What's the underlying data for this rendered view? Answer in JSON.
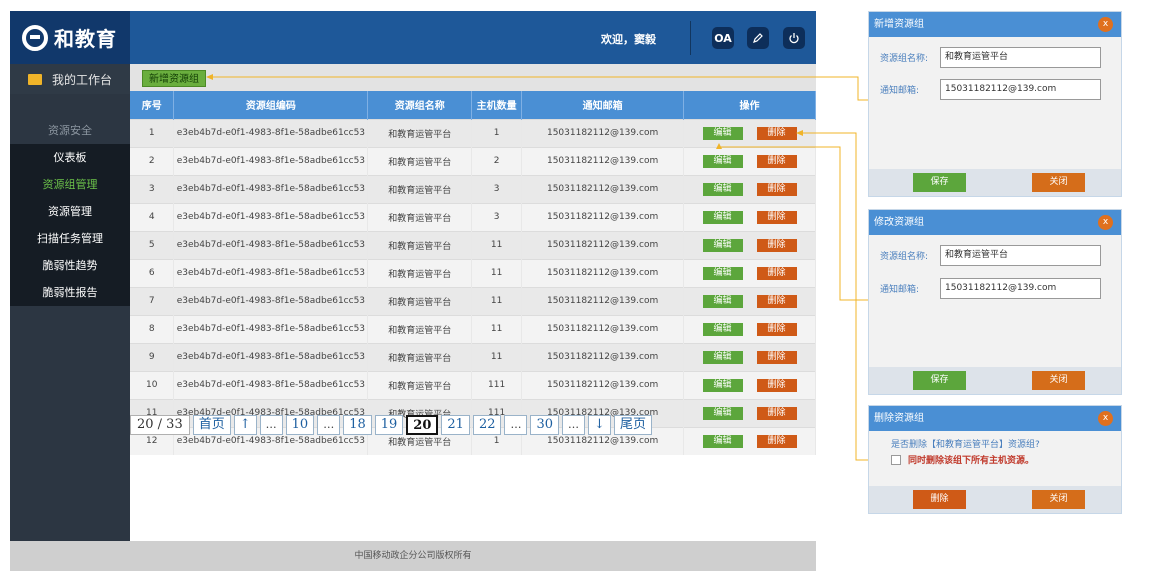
{
  "header": {
    "logo_text": "和教育",
    "welcome": "欢迎，窦毅",
    "oa_label": "OA"
  },
  "sidebar": {
    "workbench_label": "我的工作台",
    "section_title": "资源安全",
    "items": [
      {
        "label": "仪表板"
      },
      {
        "label": "资源组管理"
      },
      {
        "label": "资源管理"
      },
      {
        "label": "扫描任务管理"
      },
      {
        "label": "脆弱性趋势"
      },
      {
        "label": "脆弱性报告"
      }
    ]
  },
  "toolbar": {
    "add_label": "新增资源组"
  },
  "table": {
    "headers": [
      "序号",
      "资源组编码",
      "资源组名称",
      "主机数量",
      "通知邮箱",
      "操作"
    ],
    "edit_label": "编辑",
    "delete_label": "删除",
    "rows": [
      {
        "index": "1",
        "code": "e3eb4b7d-e0f1-4983-8f1e-58adbe61cc53",
        "name": "和教育运管平台",
        "hosts": "1",
        "email": "15031182112@139.com"
      },
      {
        "index": "2",
        "code": "e3eb4b7d-e0f1-4983-8f1e-58adbe61cc53",
        "name": "和教育运管平台",
        "hosts": "2",
        "email": "15031182112@139.com"
      },
      {
        "index": "3",
        "code": "e3eb4b7d-e0f1-4983-8f1e-58adbe61cc53",
        "name": "和教育运管平台",
        "hosts": "3",
        "email": "15031182112@139.com"
      },
      {
        "index": "4",
        "code": "e3eb4b7d-e0f1-4983-8f1e-58adbe61cc53",
        "name": "和教育运管平台",
        "hosts": "3",
        "email": "15031182112@139.com"
      },
      {
        "index": "5",
        "code": "e3eb4b7d-e0f1-4983-8f1e-58adbe61cc53",
        "name": "和教育运管平台",
        "hosts": "11",
        "email": "15031182112@139.com"
      },
      {
        "index": "6",
        "code": "e3eb4b7d-e0f1-4983-8f1e-58adbe61cc53",
        "name": "和教育运管平台",
        "hosts": "11",
        "email": "15031182112@139.com"
      },
      {
        "index": "7",
        "code": "e3eb4b7d-e0f1-4983-8f1e-58adbe61cc53",
        "name": "和教育运管平台",
        "hosts": "11",
        "email": "15031182112@139.com"
      },
      {
        "index": "8",
        "code": "e3eb4b7d-e0f1-4983-8f1e-58adbe61cc53",
        "name": "和教育运管平台",
        "hosts": "11",
        "email": "15031182112@139.com"
      },
      {
        "index": "9",
        "code": "e3eb4b7d-e0f1-4983-8f1e-58adbe61cc53",
        "name": "和教育运管平台",
        "hosts": "11",
        "email": "15031182112@139.com"
      },
      {
        "index": "10",
        "code": "e3eb4b7d-e0f1-4983-8f1e-58adbe61cc53",
        "name": "和教育运管平台",
        "hosts": "111",
        "email": "15031182112@139.com"
      },
      {
        "index": "11",
        "code": "e3eb4b7d-e0f1-4983-8f1e-58adbe61cc53",
        "name": "和教育运管平台",
        "hosts": "111",
        "email": "15031182112@139.com"
      },
      {
        "index": "12",
        "code": "e3eb4b7d-e0f1-4983-8f1e-58adbe61cc53",
        "name": "和教育运管平台",
        "hosts": "1",
        "email": "15031182112@139.com"
      }
    ]
  },
  "pagination": {
    "info": "20 / 33",
    "first": "首页",
    "up": "↑",
    "pages": [
      "…",
      "10",
      "…",
      "18",
      "19",
      "20",
      "21",
      "22",
      "…",
      "30",
      "…"
    ],
    "current": "20",
    "down": "↓",
    "last": "尾页"
  },
  "footer": {
    "copyright": "中国移动政企分公司版权所有"
  },
  "dialogs": {
    "add": {
      "title": "新增资源组",
      "name_label": "资源组名称:",
      "name_value": "和教育运管平台",
      "email_label": "通知邮箱:",
      "email_value": "15031182112@139.com",
      "save_label": "保存",
      "close_label": "关闭"
    },
    "edit": {
      "title": "修改资源组",
      "name_label": "资源组名称:",
      "name_value": "和教育运管平台",
      "email_label": "通知邮箱:",
      "email_value": "15031182112@139.com",
      "save_label": "保存",
      "close_label": "关闭"
    },
    "delete": {
      "title": "删除资源组",
      "question": "是否删除【和教育运管平台】资源组?",
      "checkbox_label": "同时删除该组下所有主机资源。",
      "delete_label": "删除",
      "close_label": "关闭"
    },
    "close_glyph": "x"
  },
  "colors": {
    "brand_blue": "#1e5899",
    "accent_green": "#5ca63c",
    "accent_orange": "#cf5a17",
    "annotation_yellow": "#f0b429"
  }
}
